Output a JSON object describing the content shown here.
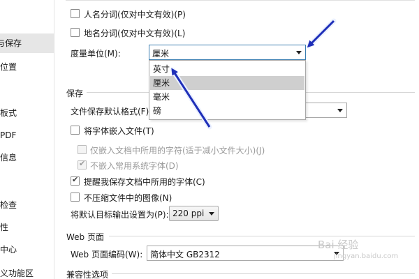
{
  "sidebar": {
    "items": [
      {
        "label": "与保存",
        "selected": true
      },
      {
        "label": "位置",
        "selected": false
      },
      {
        "label": "板式",
        "selected": false
      },
      {
        "label": "PDF",
        "selected": false
      },
      {
        "label": "信息",
        "selected": false
      },
      {
        "label": "检查",
        "selected": false
      },
      {
        "label": "性",
        "selected": false
      },
      {
        "label": "中心",
        "selected": false
      },
      {
        "label": "义功能区",
        "selected": false
      }
    ]
  },
  "segmentation": {
    "name_seg_label": "人名分词(仅对中文有效)(P)",
    "name_seg_checked": false,
    "place_seg_label": "地名分词(仅对中文有效)(L)",
    "place_seg_checked": false
  },
  "measure": {
    "label": "度量单位(M):",
    "selected": "厘米",
    "options": [
      "英寸",
      "厘米",
      "毫米",
      "磅"
    ],
    "highlighted": "厘米"
  },
  "save_section": {
    "title": "保存",
    "default_format_label": "文件保存默认格式(F):",
    "embed_fonts_label": "将字体嵌入文件(T)",
    "embed_fonts_checked": false,
    "embed_used_only_label": "仅嵌入文档中所用的字符(适于减小文件大小)(J)",
    "embed_used_only_checked": false,
    "no_common_fonts_label": "不嵌入常用系统字体(D)",
    "no_common_fonts_checked": true,
    "remind_fonts_label": "提醒我保存文档中所用的字体(C)",
    "remind_fonts_checked": true,
    "no_compress_label": "不压缩文件中的图像(N)",
    "no_compress_checked": false,
    "default_output_label": "将默认目标输出设置为(P):",
    "default_output_value": "220 ppi"
  },
  "web_section": {
    "title": "Web 页面",
    "encoding_label": "Web 页面编码(W):",
    "encoding_value": "简体中文 GB2312"
  },
  "compat_section": {
    "title": "兼容性选项"
  },
  "watermark": {
    "text": "Bai 经验",
    "sub": "jingyan.baidu.com"
  },
  "colors": {
    "arrow": "#1f2fb8",
    "selected_side": "#e6e6e6",
    "highlight": "#cfcfcf",
    "focus_border": "#3c7fb1"
  }
}
